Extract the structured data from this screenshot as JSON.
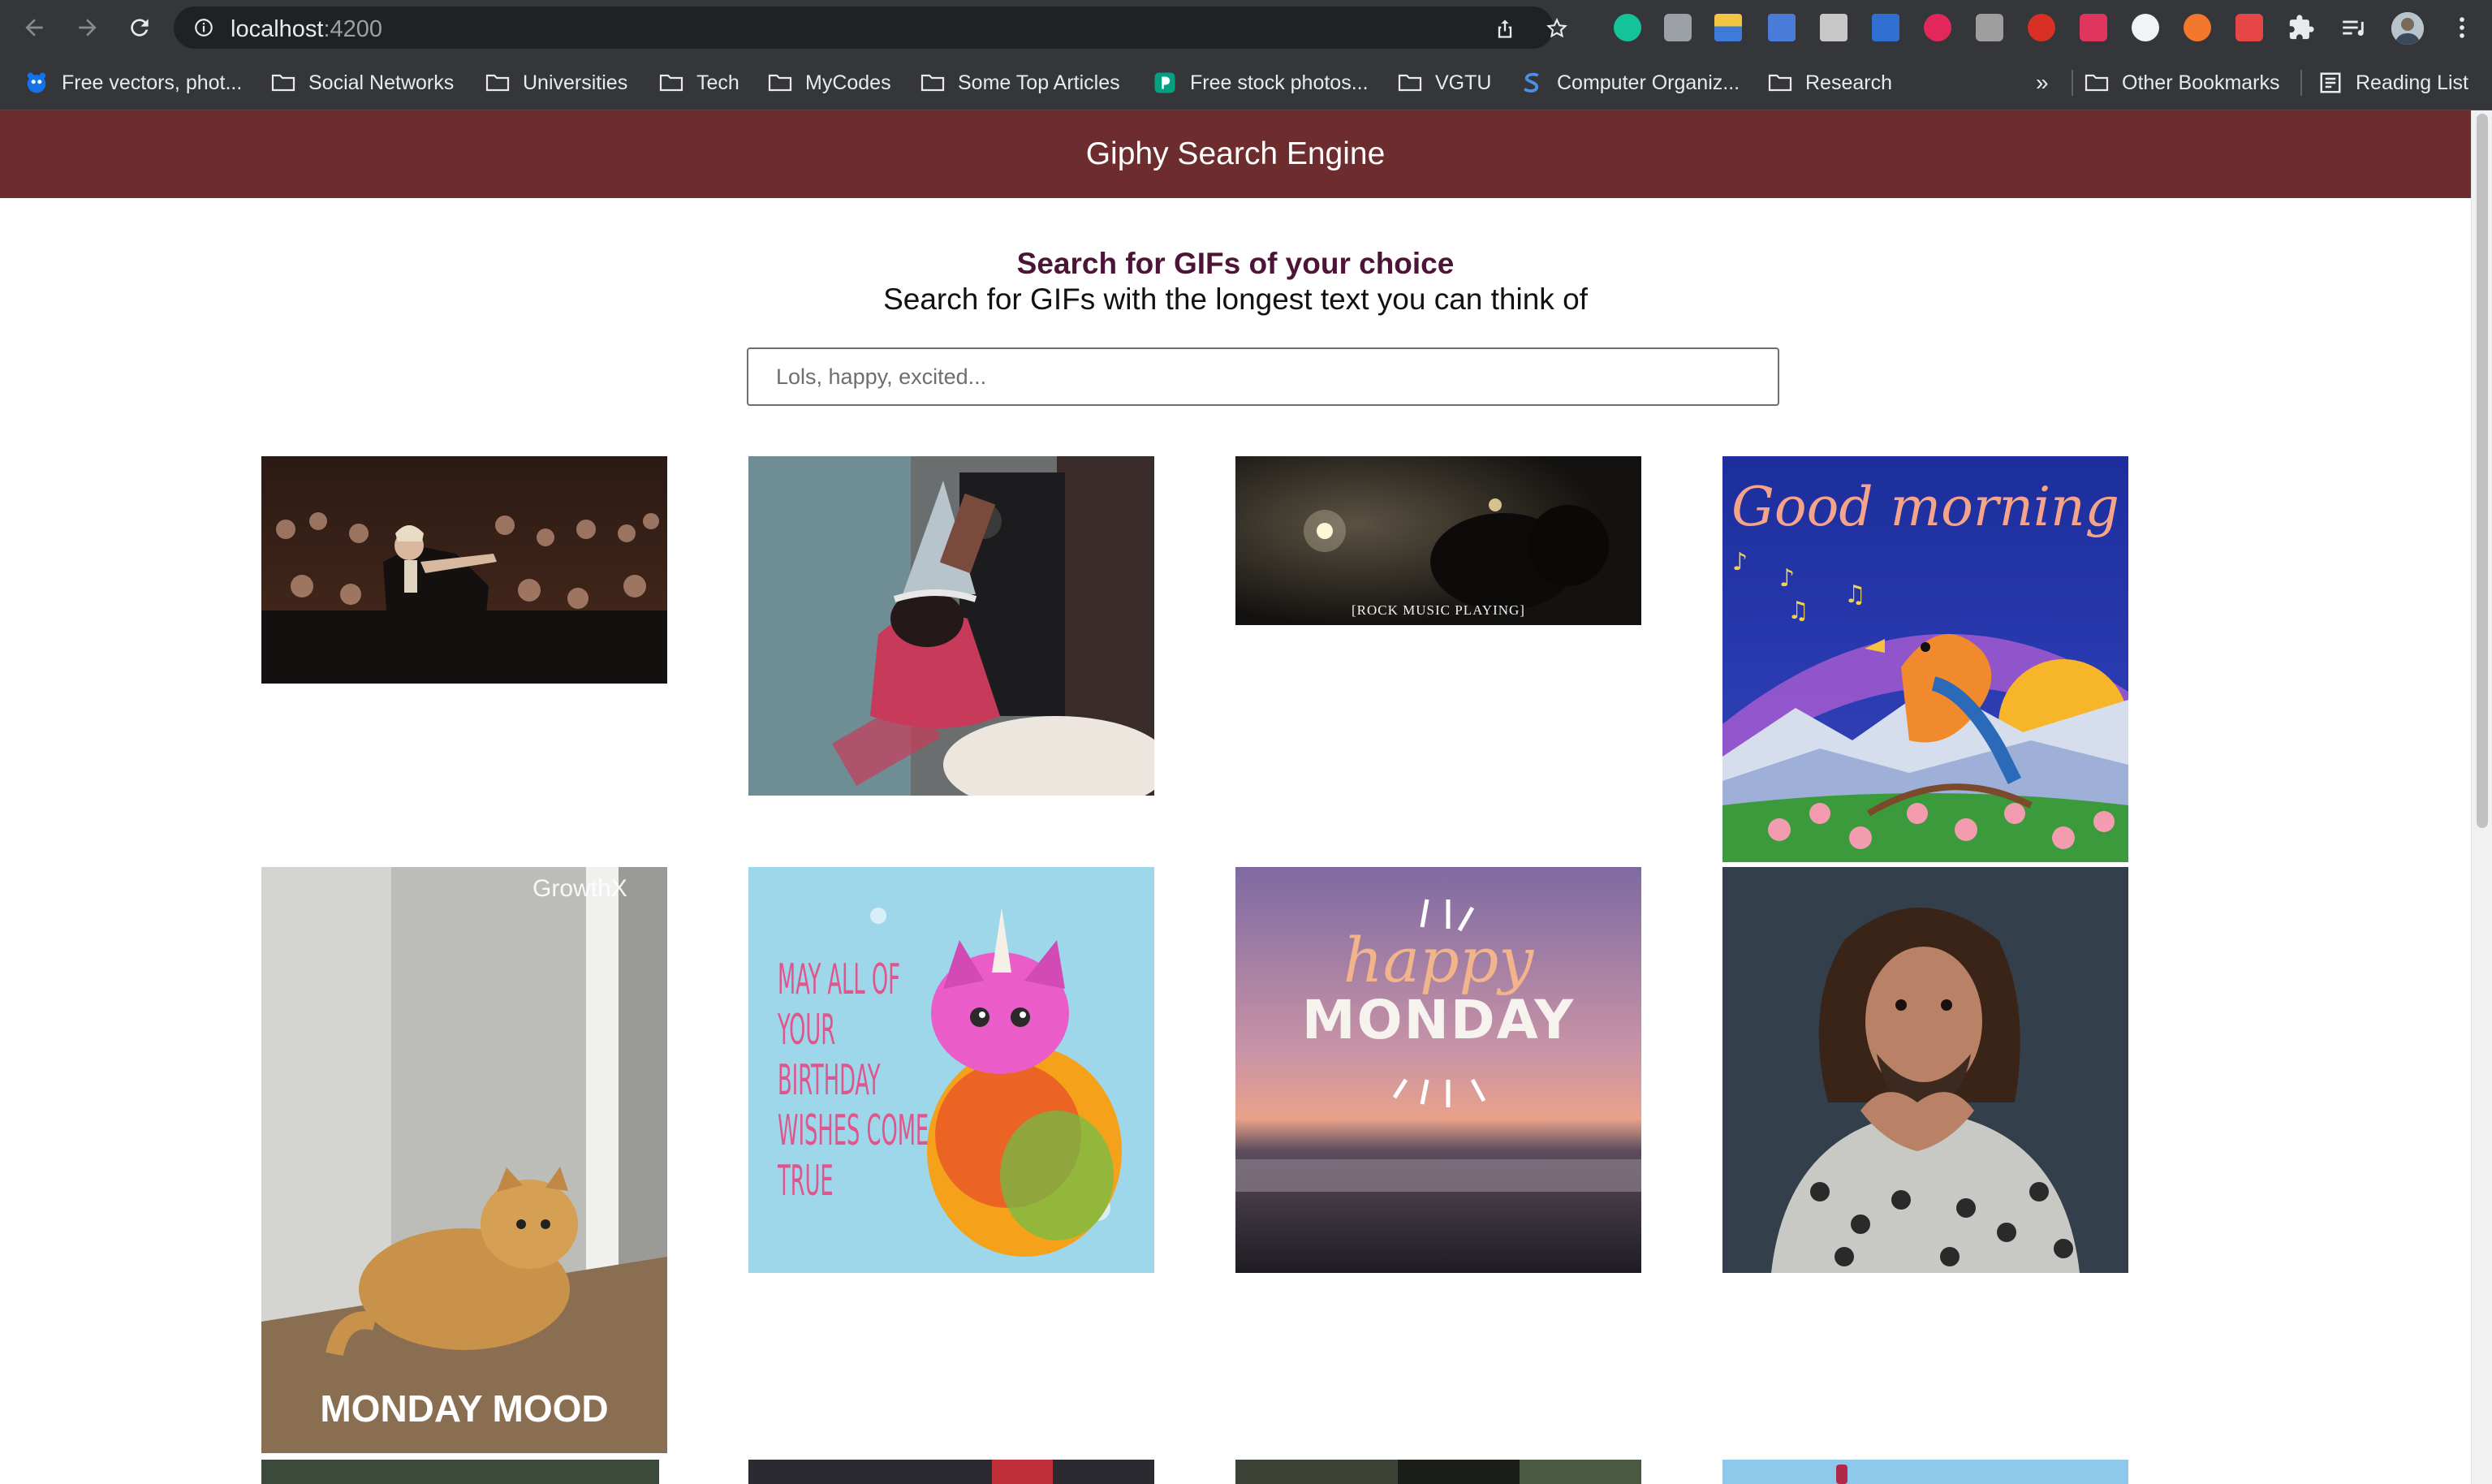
{
  "browser": {
    "url_host": "localhost",
    "url_port": ":4200"
  },
  "bookmarks": [
    {
      "label": "Free vectors, phot...",
      "icon": "freepik-icon"
    },
    {
      "label": "Social Networks",
      "icon": "folder-icon"
    },
    {
      "label": "Universities",
      "icon": "folder-icon"
    },
    {
      "label": "Tech",
      "icon": "folder-icon"
    },
    {
      "label": "MyCodes",
      "icon": "folder-icon"
    },
    {
      "label": "Some Top Articles",
      "icon": "folder-icon"
    },
    {
      "label": "Free stock photos...",
      "icon": "pexels-icon"
    },
    {
      "label": "VGTU",
      "icon": "folder-icon"
    },
    {
      "label": "Computer Organiz...",
      "icon": "s-site-icon"
    },
    {
      "label": "Research",
      "icon": "folder-icon"
    }
  ],
  "bookmarks_overflow": "»",
  "other_bookmarks": "Other Bookmarks",
  "reading_list": "Reading List",
  "app": {
    "title": "Giphy Search Engine",
    "headline": "Search for GIFs of your choice",
    "subheadline": "Search for GIFs with the longest text you can think of",
    "search_placeholder": "Lols, happy, excited..."
  },
  "gifs": [
    {
      "id": "applause",
      "caption": ""
    },
    {
      "id": "party-hat",
      "caption": ""
    },
    {
      "id": "rock-music",
      "caption": "[ROCK MUSIC PLAYING]"
    },
    {
      "id": "good-morning",
      "caption": "Good morning"
    },
    {
      "id": "monday-mood",
      "caption": "MONDAY MOOD",
      "watermark": "GrowthX"
    },
    {
      "id": "birthday-cat",
      "caption": "MAY ALL OF YOUR BIRTHDAY WISHES COME TRUE"
    },
    {
      "id": "happy-monday",
      "caption_top": "happy",
      "caption_bottom": "MONDAY"
    },
    {
      "id": "heart-hands",
      "caption": ""
    },
    {
      "id": "row3-a",
      "caption": ""
    },
    {
      "id": "row3-b",
      "caption": ""
    },
    {
      "id": "row3-c",
      "caption": ""
    },
    {
      "id": "row3-d",
      "caption": ""
    }
  ]
}
